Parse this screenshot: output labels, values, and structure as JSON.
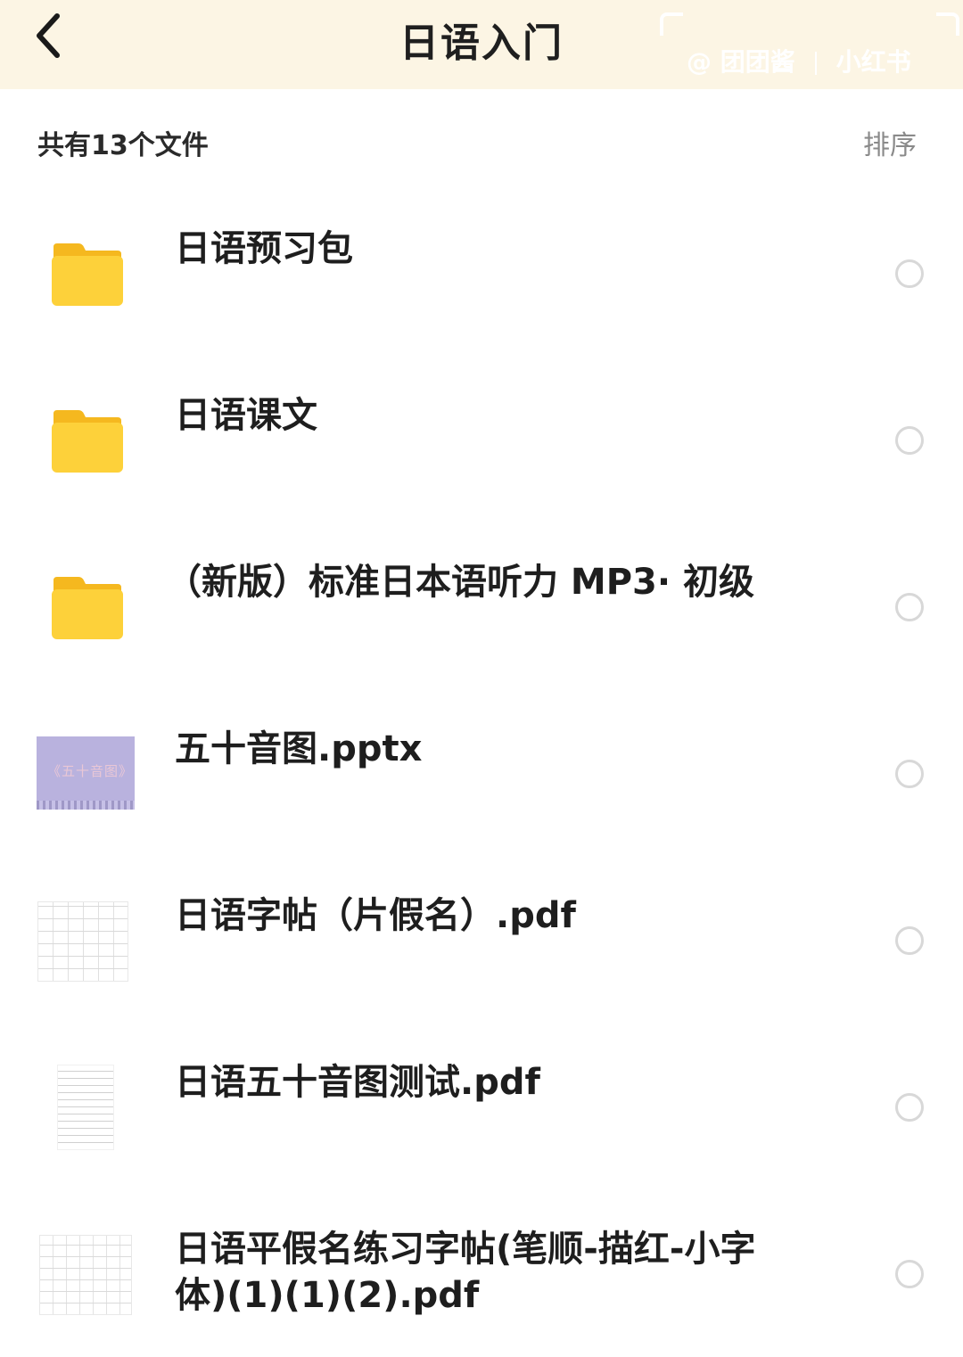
{
  "header": {
    "title": "日语入门",
    "back_icon": "chevron-left-icon",
    "watermark_user": "@ 团团酱",
    "watermark_brand": "小红书"
  },
  "summary": {
    "count_label": "共有13个文件",
    "sort_label": "排序"
  },
  "files": [
    {
      "name": "日语预习包",
      "type": "folder",
      "icon": "folder-icon"
    },
    {
      "name": "日语课文",
      "type": "folder",
      "icon": "folder-icon"
    },
    {
      "name": "（新版）标准日本语听力 MP3· 初级",
      "type": "folder",
      "icon": "folder-icon"
    },
    {
      "name": "五十音图.pptx",
      "type": "pptx",
      "thumb_text": "《五十音图》"
    },
    {
      "name": "日语字帖（片假名）.pdf",
      "type": "pdf"
    },
    {
      "name": "日语五十音图测试.pdf",
      "type": "pdf"
    },
    {
      "name": "日语平假名练习字帖(笔顺-描红-小字体)(1)(1)(2).pdf",
      "type": "pdf"
    }
  ],
  "colors": {
    "header_bg": "#fcf5e4",
    "folder_yellow": "#fdd13a",
    "folder_tab": "#f5b81f",
    "radio_border": "#d8d8d8"
  }
}
